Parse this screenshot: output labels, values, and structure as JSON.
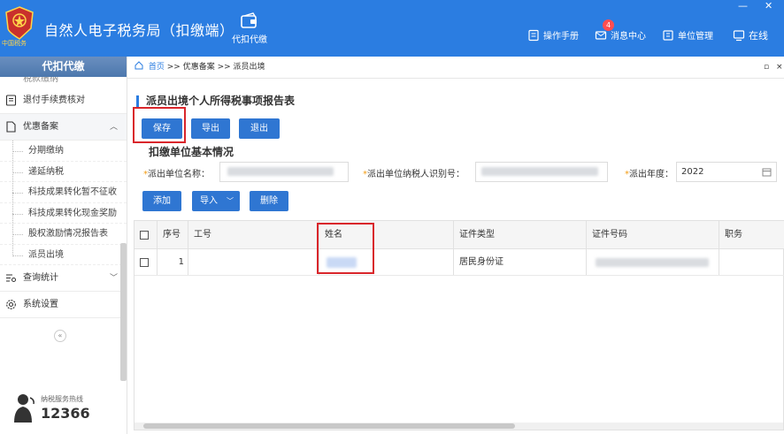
{
  "header": {
    "app_title": "自然人电子税务局（扣缴端）",
    "logo_text": "中国税务",
    "module_label": "代扣代缴",
    "manual_label": "操作手册",
    "message_label": "消息中心",
    "message_count": "4",
    "unit_label": "单位管理",
    "online_label": "在线",
    "win_min": "—",
    "win_close": "✕",
    "brand_color": "#2b7de1"
  },
  "sidebar": {
    "title": "代扣代缴",
    "partial_item": "税款缴纳",
    "items": [
      {
        "label": "退付手续费核对",
        "icon": "document-check-icon"
      },
      {
        "label": "优惠备案",
        "icon": "file-icon",
        "open": true
      },
      {
        "label": "查询统计",
        "icon": "query-list-icon"
      },
      {
        "label": "系统设置",
        "icon": "gear-icon"
      }
    ],
    "sub_items": [
      "分期缴纳",
      "递延纳税",
      "科技成果转化暂不征收",
      "科技成果转化现金奖励",
      "股权激励情况报告表",
      "派员出境"
    ],
    "collapse_glyph": "«",
    "hotline_label": "纳税服务热线",
    "hotline_number": "12366"
  },
  "breadcrumb": {
    "home": "首页",
    "path": ">> 优惠备案 >> 派员出境",
    "ctrl_min": "▫",
    "ctrl_close": "×"
  },
  "form": {
    "title": "派员出境个人所得税事项报告表",
    "buttons": {
      "save": "保存",
      "export": "导出",
      "exit": "退出"
    },
    "section_title": "扣缴单位基本情况",
    "fields": {
      "unit_name_label": "派出单位名称：",
      "taxpayer_id_label": "派出单位纳税人识别号：",
      "year_label": "派出年度：",
      "year_value": "2022"
    },
    "table_buttons": {
      "add": "添加",
      "import": "导入",
      "delete": "删除"
    },
    "table": {
      "columns": [
        "序号",
        "工号",
        "姓名",
        "证件类型",
        "证件号码",
        "职务"
      ],
      "rows": [
        {
          "seq": "1",
          "emp_no": "",
          "id_type": "居民身份证"
        }
      ]
    }
  }
}
